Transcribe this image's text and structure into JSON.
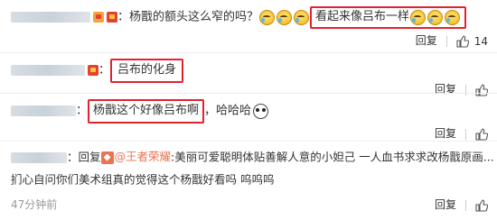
{
  "comments": [
    {
      "text": "：杨戬的额头这么窄的吗？",
      "highlight": "看起来像吕布一样",
      "reply_label": "回复",
      "like_count": "14"
    },
    {
      "text": "：",
      "highlight": "吕布的化身",
      "reply_label": "回复"
    },
    {
      "text": "：",
      "highlight": "杨戬这个好像吕布啊",
      "tail": "，哈哈哈",
      "reply_label": "回复"
    },
    {
      "prefix": "：回复",
      "mention": "@王者荣耀",
      "line1": ":美丽可爱聪明体贴善解人意的小妲己 一人血书求求改杨戬原画...",
      "line2": "扪心自问你们美术组真的觉得这个杨戬好看吗 呜呜呜",
      "timestamp": "47分钟前",
      "reply_label": "回复"
    }
  ],
  "icons": {
    "badge": "vip-badge-icon",
    "like": "thumbs-up-icon",
    "emoji": "crying-laugh-emoji",
    "panda": "panda-emoji",
    "mention": "weibo-mention-icon"
  },
  "colors": {
    "highlight_border": "#e0232f",
    "mention": "#eb7350",
    "timestamp": "#999999"
  }
}
